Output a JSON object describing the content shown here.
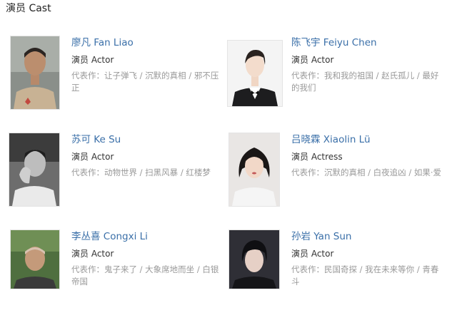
{
  "section": {
    "title": "演员 Cast"
  },
  "works_label": "代表作：",
  "cast": [
    {
      "name": "廖凡 Fan Liao",
      "role": "演员 Actor",
      "works": "让子弹飞 / 沉默的真相 / 邪不压正"
    },
    {
      "name": "陈飞宇 Feiyu Chen",
      "role": "演员 Actor",
      "works": "我和我的祖国 / 赵氏孤儿 / 最好的我们"
    },
    {
      "name": "苏可 Ke Su",
      "role": "演员 Actor",
      "works": "动物世界 / 扫黑风暴 / 红楼梦"
    },
    {
      "name": "吕晓霖 Xiaolin Lü",
      "role": "演员 Actress",
      "works": "沉默的真相 / 白夜追凶 / 如果·爱"
    },
    {
      "name": "李丛喜 Congxi Li",
      "role": "演员 Actor",
      "works": "鬼子来了 / 大象席地而坐 / 白银帝国"
    },
    {
      "name": "孙岩 Yan Sun",
      "role": "演员 Actor",
      "works": "民国奇探 / 我在未来等你 / 青春斗"
    }
  ]
}
